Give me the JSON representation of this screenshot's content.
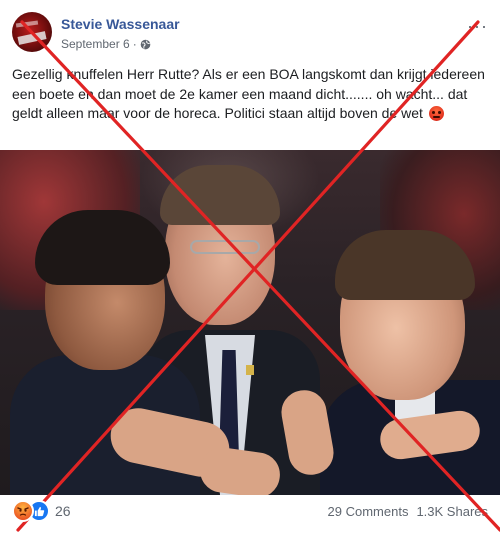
{
  "post": {
    "author": "Stevie Wassenaar",
    "date": "September 6",
    "meta_separator": "·",
    "privacy_icon": "globe-icon",
    "more_label": "···",
    "message": "Gezellig knuffelen Herr Rutte? Als er een BOA langskomt dan krijgt iedereen een boete en dan moet de 2e kamer een maand dicht....... oh wacht... dat geldt alleen maar voor de horeca. Politici staan altijd boven de wet",
    "message_emoji": "angry-face-emoji"
  },
  "footer": {
    "reaction_icons": [
      "angry-reaction-icon",
      "like-reaction-icon"
    ],
    "reaction_count": "26",
    "comments": "29 Comments",
    "shares": "1.3K Shares"
  },
  "overlay": {
    "type": "red-x-cross",
    "color": "#e02424"
  },
  "colors": {
    "author_link": "#385898",
    "meta_text": "#606770",
    "body_text": "#1c1e21",
    "like_blue": "#1877f2"
  }
}
